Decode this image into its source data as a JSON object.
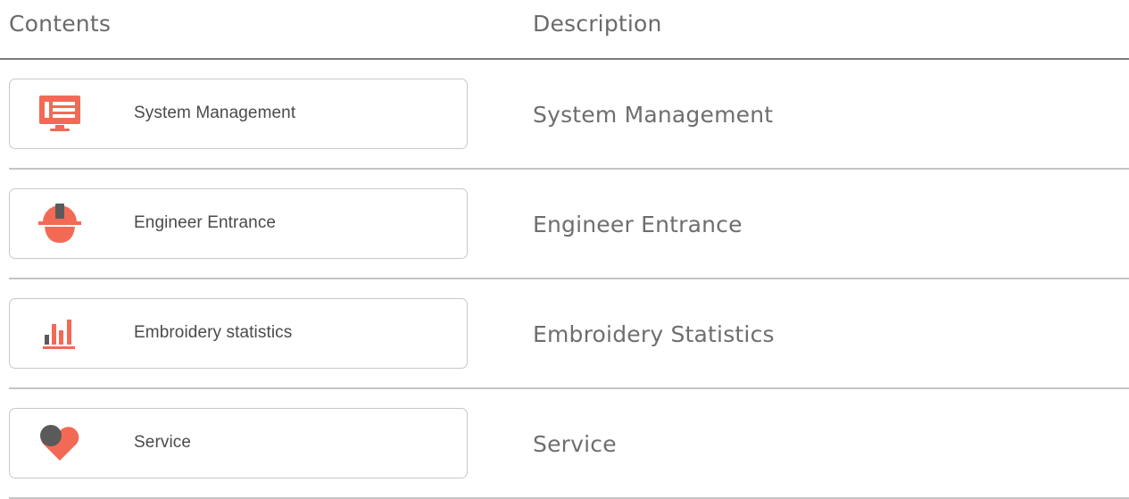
{
  "header": {
    "contents_label": "Contents",
    "description_label": "Description"
  },
  "rows": [
    {
      "card_label": "System Management",
      "description": "System Management",
      "icon": "monitor-list-icon"
    },
    {
      "card_label": "Engineer Entrance",
      "description": "Engineer Entrance",
      "icon": "hard-hat-icon"
    },
    {
      "card_label": "Embroidery statistics",
      "description": "Embroidery Statistics",
      "icon": "bar-chart-icon"
    },
    {
      "card_label": "Service",
      "description": "Service",
      "icon": "heart-service-icon"
    }
  ],
  "colors": {
    "accent": "#f26a56",
    "dark_accent": "#5a5a5a",
    "header_rule": "#7a7a7a",
    "row_divider": "#c4c4c4"
  }
}
